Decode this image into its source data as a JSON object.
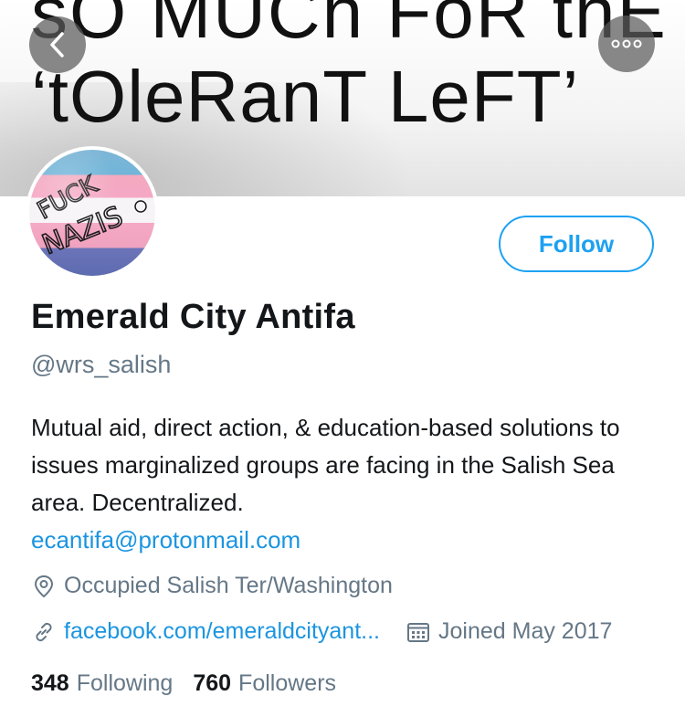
{
  "banner": {
    "line1": "sO MUCh FoR thE",
    "line2": "‘tOleRanT LeFT’"
  },
  "avatar": {
    "text_line1": "FUCK",
    "text_line2": "NAZIS"
  },
  "nav": {
    "back_icon": "chevron-left",
    "more_icon": "more-horizontal"
  },
  "profile": {
    "follow_label": "Follow",
    "name": "Emerald City Antifa",
    "handle": "@wrs_salish",
    "bio": "Mutual aid, direct action, & education-based solutions to issues marginalized groups are facing in the Salish Sea area. Decentralized.",
    "bio_email": "ecantifa@protonmail.com",
    "location": "Occupied Salish Ter/Washington",
    "website": "facebook.com/emeraldcityant...",
    "joined": "Joined May 2017"
  },
  "stats": {
    "following_count": "348",
    "following_label": "Following",
    "followers_count": "760",
    "followers_label": "Followers"
  },
  "colors": {
    "accent": "#1da1f2",
    "link": "#1b95e0",
    "secondary_text": "#657786"
  }
}
